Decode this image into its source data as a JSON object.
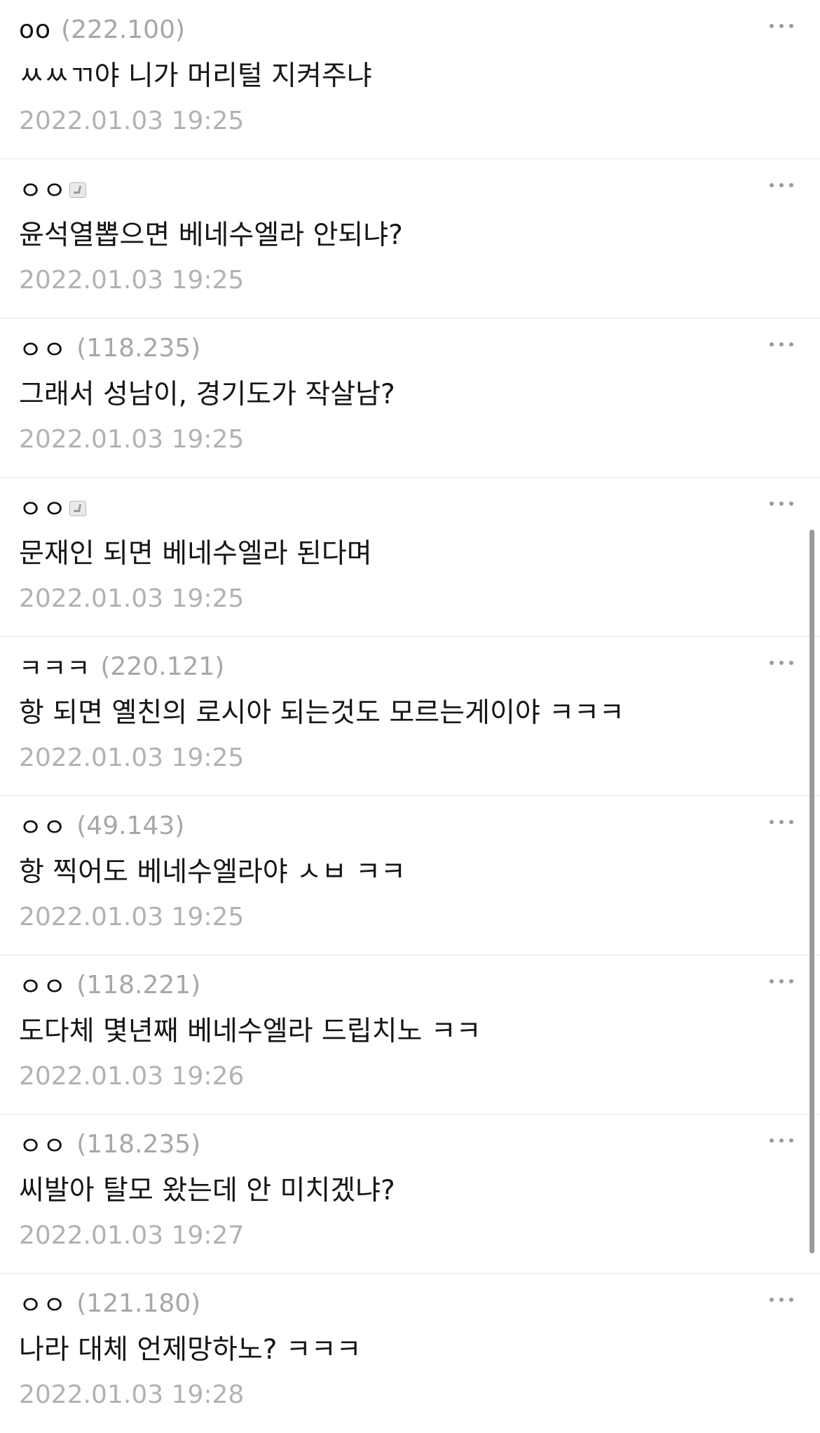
{
  "comments": [
    {
      "nick": "oo",
      "ip": "(222.100)",
      "text": "ㅆㅆㄲ야 니가 머리털 지켜주냐",
      "date": "2022.01.03 19:25",
      "fixed": false
    },
    {
      "nick": "ㅇㅇ",
      "ip": "",
      "text": "윤석열뽑으면 베네수엘라 안되냐?",
      "date": "2022.01.03 19:25",
      "fixed": true
    },
    {
      "nick": "ㅇㅇ",
      "ip": "(118.235)",
      "text": "그래서 성남이, 경기도가 작살남?",
      "date": "2022.01.03 19:25",
      "fixed": false
    },
    {
      "nick": "ㅇㅇ",
      "ip": "",
      "text": "문재인 되면 베네수엘라 된다며",
      "date": "2022.01.03 19:25",
      "fixed": true
    },
    {
      "nick": "ㅋㅋㅋ",
      "ip": "(220.121)",
      "text": "항 되면 옐친의 로시아 되는것도 모르는게이야 ㅋㅋㅋ",
      "date": "2022.01.03 19:25",
      "fixed": false
    },
    {
      "nick": "ㅇㅇ",
      "ip": "(49.143)",
      "text": "항 찍어도 베네수엘라야 ㅅㅂ ㅋㅋ",
      "date": "2022.01.03 19:25",
      "fixed": false
    },
    {
      "nick": "ㅇㅇ",
      "ip": "(118.221)",
      "text": "도다체 몇년째 베네수엘라 드립치노 ㅋㅋ",
      "date": "2022.01.03 19:26",
      "fixed": false
    },
    {
      "nick": "ㅇㅇ",
      "ip": "(118.235)",
      "text": "씨발아 탈모 왔는데 안 미치겠냐?",
      "date": "2022.01.03 19:27",
      "fixed": false
    },
    {
      "nick": "ㅇㅇ",
      "ip": "(121.180)",
      "text": "나라 대체 언제망하노? ㅋㅋㅋ",
      "date": "2022.01.03 19:28",
      "fixed": false
    }
  ],
  "icons": {
    "more": "more-horizontal-icon",
    "fixed_nick": "fixed-nickname-badge-icon"
  }
}
